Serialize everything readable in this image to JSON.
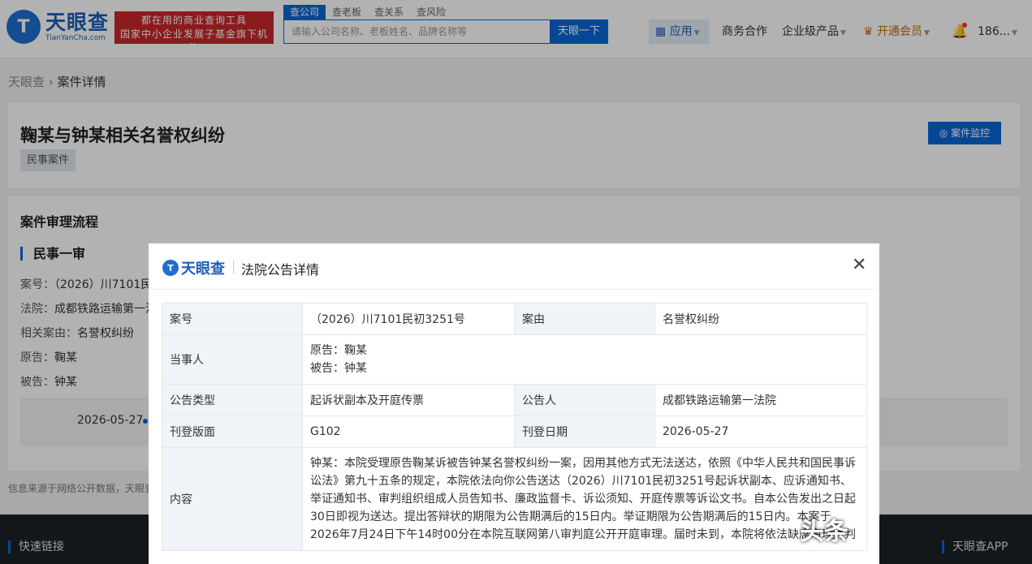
{
  "header": {
    "logo_cn": "天眼查",
    "logo_en": "TianYanCha.com",
    "slogan_line1": "都在用的商业查询工具",
    "slogan_line2": "国家中小企业发展子基金旗下机构",
    "search_tabs": [
      "查公司",
      "查老板",
      "查关系",
      "查风险"
    ],
    "search_placeholder": "请输入公司名称、老板姓名、品牌名称等",
    "search_button": "天眼一下",
    "nav_apps": "应用",
    "nav_biz": "商务合作",
    "nav_ent": "企业级产品",
    "nav_vip": "开通会员",
    "nav_user": "186..."
  },
  "breadcrumb": {
    "root": "天眼查",
    "current": "案件详情"
  },
  "case": {
    "title": "鞠某与钟某相关名誉权纠纷",
    "tag": "民事案件",
    "monitor_button": "案件监控"
  },
  "process": {
    "title": "案件审理流程",
    "stage": "民事一审",
    "case_no_label": "案号：",
    "case_no": "（2026）川7101民",
    "court_label": "法院：",
    "court": "成都铁路运输第一法",
    "cause_label": "相关案由：",
    "cause": "名誉权纠纷",
    "plaintiff_label": "原告：",
    "plaintiff": "鞠某",
    "defendant_label": "被告：",
    "defendant": "钟某",
    "date": "2026-05-27"
  },
  "source_note": "信息来源于网络公开数据，天眼查",
  "footer": {
    "left": "快速链接",
    "right": "天眼查APP"
  },
  "modal": {
    "logo": "天眼查",
    "title": "法院公告详情",
    "close": "✕",
    "rows": {
      "case_no_k": "案号",
      "case_no_v": "（2026）川7101民初3251号",
      "cause_k": "案由",
      "cause_v": "名誉权纠纷",
      "parties_k": "当事人",
      "parties_v1": "原告：鞠某",
      "parties_v2": "被告：钟某",
      "type_k": "公告类型",
      "type_v": "起诉状副本及开庭传票",
      "announcer_k": "公告人",
      "announcer_v": "成都铁路运输第一法院",
      "page_k": "刊登版面",
      "page_v": "G102",
      "date_k": "刊登日期",
      "date_v": "2026-05-27",
      "content_k": "内容",
      "content_v": "钟某：本院受理原告鞠某诉被告钟某名誉权纠纷一案，因用其他方式无法送达，依照《中华人民共和国民事诉讼法》第九十五条的规定，本院依法向你公告送达（2026）川7101民初3251号起诉状副本、应诉通知书、举证通知书、审判组织组成人员告知书、廉政监督卡、诉讼须知、开庭传票等诉讼文书。自本公告发出之日起30日即视为送达。提出答辩状的期限为公告期满后的15日内。举证期限为公告期满后的15日内。本案于2026年7月24日下午14时00分在本院互联网第八审判庭公开开庭审理。届时未到，本院将依法缺席审理并判"
    }
  },
  "watermark": "头条"
}
